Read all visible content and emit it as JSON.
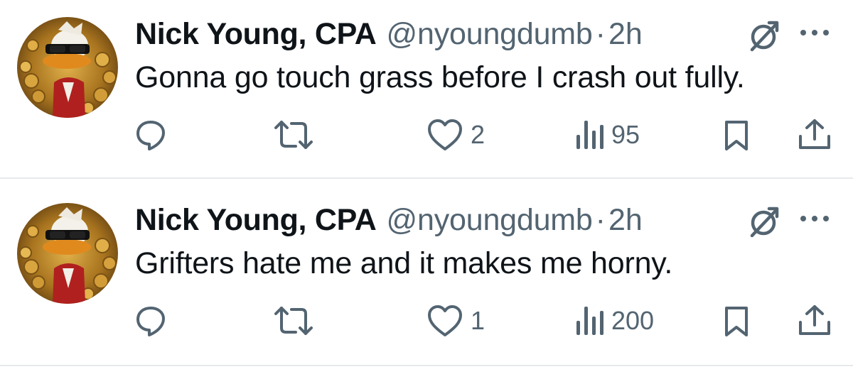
{
  "tweets": [
    {
      "author_name": "Nick Young, CPA",
      "handle": "@nyoungdumb",
      "separator": "·",
      "time": "2h",
      "text": "Gonna go touch grass before I crash out fully.",
      "likes": "2",
      "views": "95"
    },
    {
      "author_name": "Nick Young, CPA",
      "handle": "@nyoungdumb",
      "separator": "·",
      "time": "2h",
      "text": "Grifters hate me and it makes me horny.",
      "likes": "1",
      "views": "200"
    }
  ],
  "icons": {
    "reply": "reply-icon",
    "repost": "repost-icon",
    "like": "heart-icon",
    "views": "views-icon",
    "bookmark": "bookmark-icon",
    "share": "share-icon",
    "grok": "grok-icon",
    "more": "more-icon"
  },
  "colors": {
    "text": "#0f1419",
    "secondary": "#536471",
    "divider": "#e7e9eb"
  }
}
